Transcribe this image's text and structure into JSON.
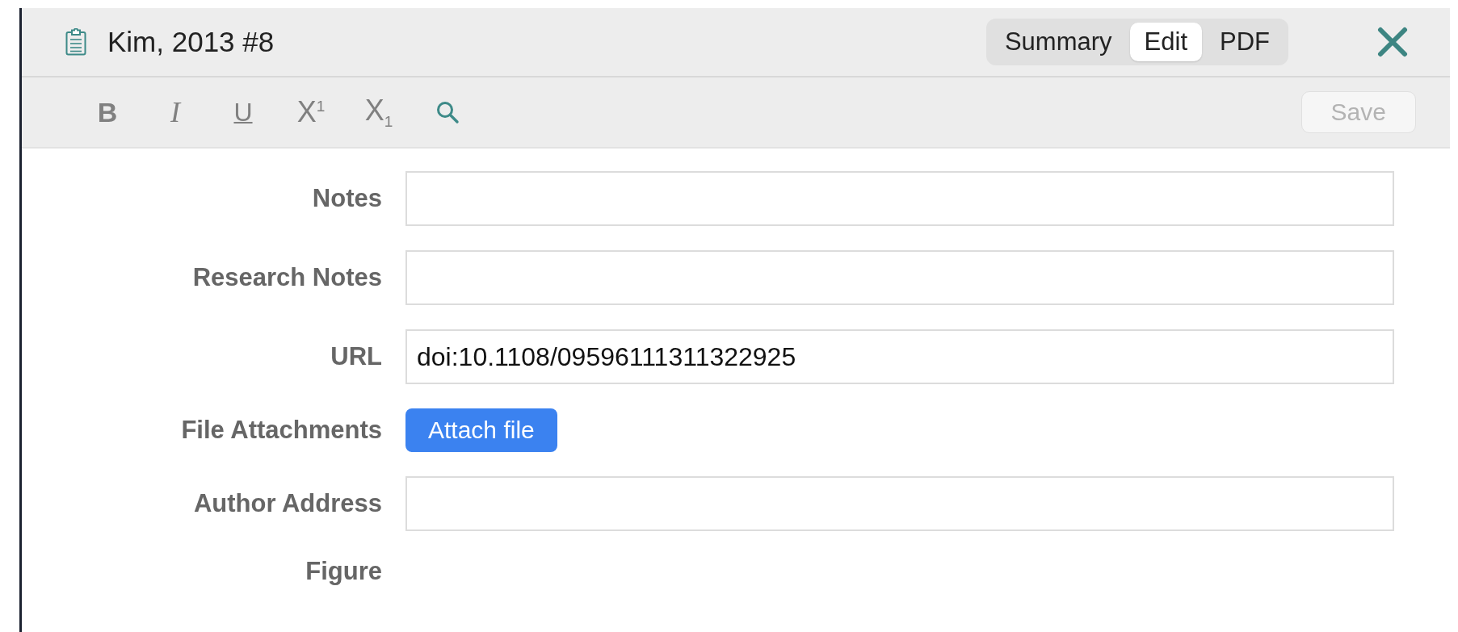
{
  "header": {
    "title": "Kim, 2013 #8"
  },
  "tabs": [
    {
      "label": "Summary",
      "selected": false
    },
    {
      "label": "Edit",
      "selected": true
    },
    {
      "label": "PDF",
      "selected": false
    }
  ],
  "toolbar": {
    "format_buttons": [
      {
        "label": "B",
        "kind": "bold"
      },
      {
        "label": "I",
        "kind": "italic"
      },
      {
        "label": "U",
        "kind": "underline"
      },
      {
        "label": "X$^{1}$",
        "kind": "superscript"
      },
      {
        "label": "X$_{1}$",
        "kind": "subscript"
      }
    ],
    "save_button": {
      "label": "Save",
      "disabled": true
    }
  },
  "fields": [
    {
      "label": "Notes",
      "kind": "text"
    },
    {
      "label": "Research Notes",
      "kind": "text"
    },
    {
      "label": "URL",
      "kind": "text",
      "value": "doi:10.1108/09596111311322925"
    },
    {
      "label": "File Attachments",
      "kind": "button",
      "button_label": "Attach file"
    },
    {
      "label": "Author Address",
      "kind": "text"
    },
    {
      "label": "Figure",
      "kind": "empty"
    }
  ]
}
